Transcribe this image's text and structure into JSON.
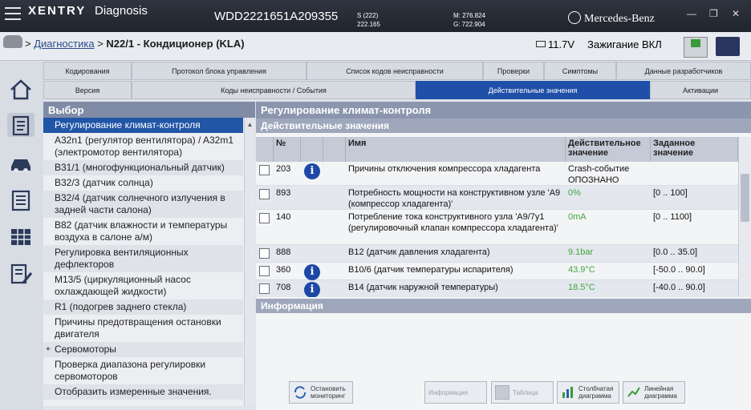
{
  "app": {
    "logo": "XENTRY",
    "name": "Diagnosis",
    "vin": "WDD2221651A209355",
    "s_line1": "S (222)",
    "s_line2": "222.165",
    "mg_line1": "M: 276.824",
    "mg_line2": "G: 722.904",
    "brand": "Mercedes-Benz"
  },
  "breadcrumb": {
    "root": "Диагностика",
    "current": "N22/1 - Кондиционер (KLA)"
  },
  "status": {
    "battery": "11.7V",
    "ignition": "Зажигание ВКЛ"
  },
  "tabs_row1": [
    "Кодирования",
    "Протокол блока управления",
    "Список кодов неисправности",
    "Проверки",
    "Симптомы",
    "Данные разработчиков"
  ],
  "tabs_row2": [
    "Версия",
    "Коды неисправности / События",
    "Действительные значения",
    "Активации"
  ],
  "left": {
    "header": "Выбор",
    "items": [
      "Регулирование климат-контроля",
      "A32n1 (регулятор вентилятора) / A32m1 (электромотор вентилятора)",
      "B31/1 (многофункциональный датчик)",
      "B32/3 (датчик солнца)",
      "B32/4 (датчик солнечного излучения в задней части салона)",
      "B82 (датчик влажности и температуры воздуха в салоне а/м)",
      "Регулировка вентиляционных дефлекторов",
      "M13/5 (циркуляционный насос охлаждающей жидкости)",
      "R1 (подогрев заднего стекла)",
      "Причины предотвращения остановки двигателя",
      "Сервомоторы",
      "Проверка диапазона регулировки сервомоторов",
      "Отобразить измеренные значения."
    ]
  },
  "main": {
    "title": "Регулирование климат-контроля",
    "subtitle": "Действительные значения",
    "columns": {
      "no": "№",
      "name": "Имя",
      "actual": "Действительное значение",
      "target": "Заданное значение"
    },
    "rows": [
      {
        "no": "203",
        "name": "Причины отключения компрессора хладагента",
        "actual": "Crash-событие ОПОЗНАНО",
        "target": ""
      },
      {
        "no": "893",
        "name": "Потребность мощности на конструктивном узле 'A9 (компрессор хладагента)'",
        "actual": "0%",
        "target": "[0 .. 100]"
      },
      {
        "no": "140",
        "name": "Потребление тока конструктивного узла 'A9/7y1 (регулировочный клапан компрессора хладагента)'",
        "actual": "0mA",
        "target": "[0 .. 1100]"
      },
      {
        "no": "888",
        "name": "B12 (датчик давления хладагента)",
        "actual": "9.1bar",
        "target": "[0.0 .. 35.0]"
      },
      {
        "no": "360",
        "name": "B10/6 (датчик температуры испарителя)",
        "actual": "43.9°C",
        "target": "[-50.0 .. 90.0]"
      },
      {
        "no": "708",
        "name": "B14 (датчик наружной температуры)",
        "actual": "18.5°C",
        "target": "[-40.0 .. 90.0]"
      }
    ],
    "info_header": "Информация"
  },
  "toolbar": {
    "stop": "Остановить мониторинг",
    "info": "Информация",
    "table": "Таблица",
    "bar": "Столбчатая диаграмма",
    "line": "Линейная диаграмма"
  }
}
